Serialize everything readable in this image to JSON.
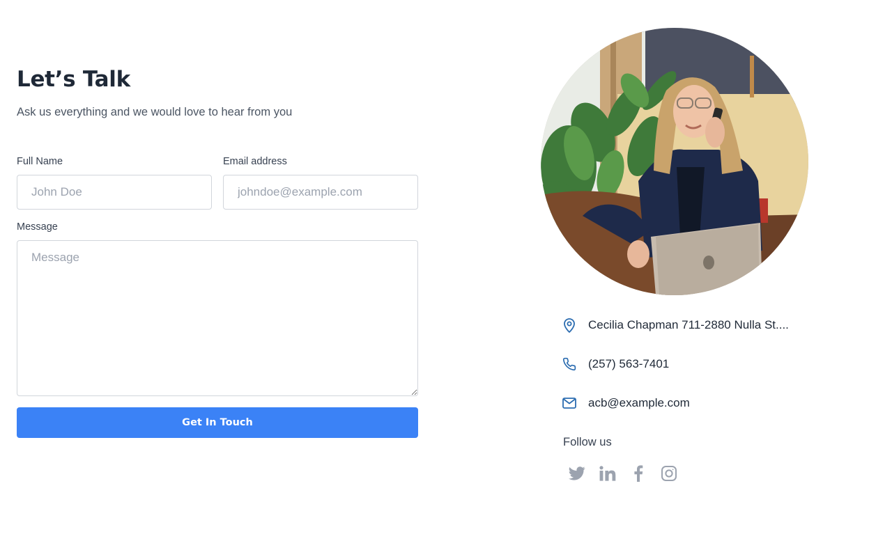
{
  "header": {
    "title": "Let’s Talk",
    "subtitle": "Ask us everything and we would love to hear from you"
  },
  "form": {
    "name_label": "Full Name",
    "name_placeholder": "John Doe",
    "email_label": "Email address",
    "email_placeholder": "johndoe@example.com",
    "message_label": "Message",
    "message_placeholder": "Message",
    "submit_label": "Get In Touch"
  },
  "contact": {
    "address": "Cecilia Chapman 711-2880 Nulla St....",
    "phone": "(257) 563-7401",
    "email": "acb@example.com",
    "icons": [
      "map-pin-icon",
      "phone-icon",
      "mail-icon"
    ]
  },
  "social": {
    "follow_label": "Follow us",
    "icons": [
      "twitter-icon",
      "linkedin-icon",
      "facebook-icon",
      "instagram-icon"
    ]
  },
  "colors": {
    "accent": "#3b82f6",
    "icon_blue": "#2b6cb0",
    "social_gray": "#9ca3af",
    "title": "#1f2937"
  }
}
